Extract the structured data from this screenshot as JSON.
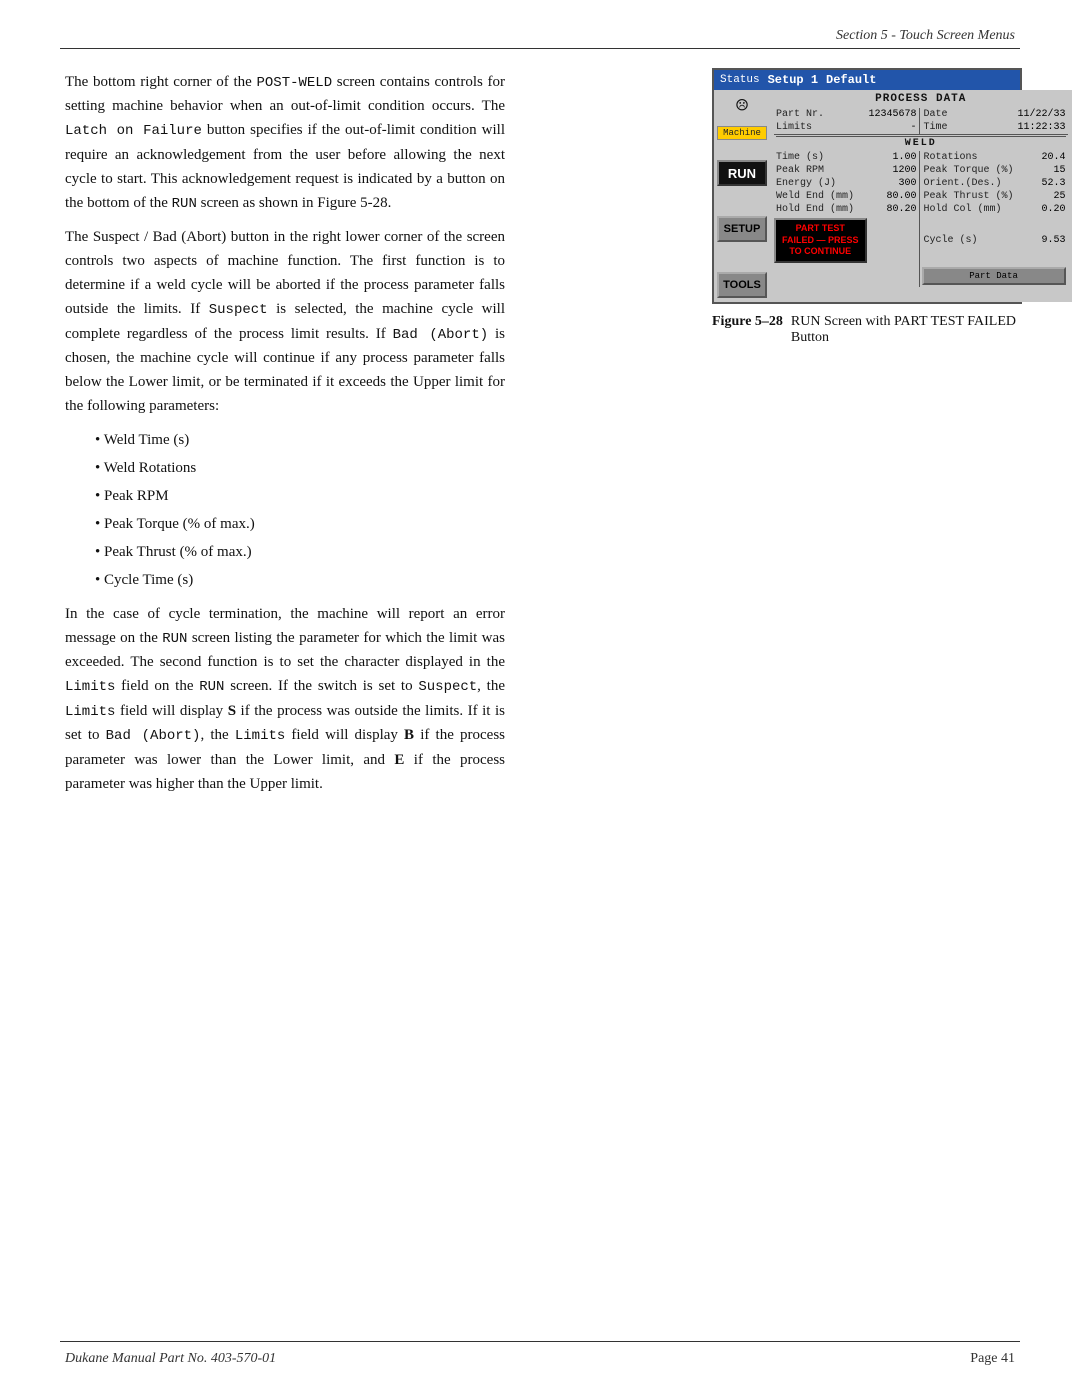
{
  "header": {
    "section_text": "Section 5 - Touch Screen Menus"
  },
  "footer": {
    "left_text": "Dukane Manual Part No. 403-570-01",
    "right_text": "Page   41"
  },
  "body_text": {
    "para1": "The bottom right corner of the POST-WELD screen contains controls for setting machine behavior when an out-of-limit condition occurs. The Latch on Failure button specifies if the out-of-limit condition will require an acknowledgement from the user before allowing the next cycle to start. This acknowledgement request is indicated by a button on the bottom of the RUN screen as shown in Figure 5-28.",
    "para2": "The Suspect / Bad (Abort) button in the right lower corner of the screen controls two aspects of machine function. The first function is to determine if a weld cycle will be aborted if the process parameter falls outside the limits. If Suspect is selected, the machine cycle will complete regardless of the process limit results. If Bad (Abort) is chosen, the machine cycle will continue if any process parameter falls below the Lower limit, or be terminated if it exceeds the Upper limit for the following parameters:",
    "bullet1": "Weld Time (s)",
    "bullet2": "Weld Rotations",
    "bullet3": "Peak RPM",
    "bullet4": "Peak Torque (% of max.)",
    "bullet5": "Peak Thrust (% of max.)",
    "bullet6": "Cycle Time (s)",
    "para3": "In the case of cycle termination, the machine will report an error message on the RUN screen listing the parameter for which the limit was exceeded. The second function is to set the character displayed in the Limits field on the RUN screen. If the switch is set to Suspect, the Limits field will display S if the process was outside the limits. If it is set to Bad (Abort), the Limits field will display B if the process parameter was lower than the Lower limit, and E if the process parameter was higher than the Upper limit."
  },
  "machine_screen": {
    "header_status": "Status",
    "header_setup": "Setup 1",
    "header_default": "Default",
    "smiley": "☹",
    "machine_label": "Machine",
    "btn_run": "RUN",
    "btn_setup": "SETUP",
    "btn_tools": "TOOLS",
    "process_data_title": "PROCESS DATA",
    "part_nr_label": "Part Nr.",
    "part_nr_value": "12345678",
    "date_label": "Date",
    "date_value": "11/22/33",
    "limits_label": "Limits",
    "limits_value": "-",
    "time_label": "Time",
    "time_value": "11:22:33",
    "weld_section": "WELD",
    "time_s_label": "Time (s)",
    "time_s_value": "1.00",
    "rotations_label": "Rotations",
    "rotations_value": "20.4",
    "peak_rpm_label": "Peak RPM",
    "peak_rpm_value": "1200",
    "peak_torque_label": "Peak Torque (%)",
    "peak_torque_value": "15",
    "energy_label": "Energy (J)",
    "energy_value": "300",
    "orient_label": "Orient.(Des.)",
    "orient_value": "52.3",
    "weld_end_label": "Weld End (mm)",
    "weld_end_value": "80.00",
    "peak_thrust_label": "Peak Thrust (%)",
    "peak_thrust_value": "25",
    "hold_end_label": "Hold End (mm)",
    "hold_end_value": "80.20",
    "hold_col_label": "Hold Col (mm)",
    "hold_col_value": "0.20",
    "cycle_s_label": "Cycle (s)",
    "cycle_s_value": "9.53",
    "btn_part_test_line1": "PART TEST",
    "btn_part_test_line2": "FAILED — PRESS",
    "btn_part_test_line3": "TO CONTINUE",
    "btn_part_data": "Part Data"
  },
  "figure_caption": {
    "label": "Figure 5–28",
    "text": "RUN Screen with PART TEST FAILED Button"
  }
}
